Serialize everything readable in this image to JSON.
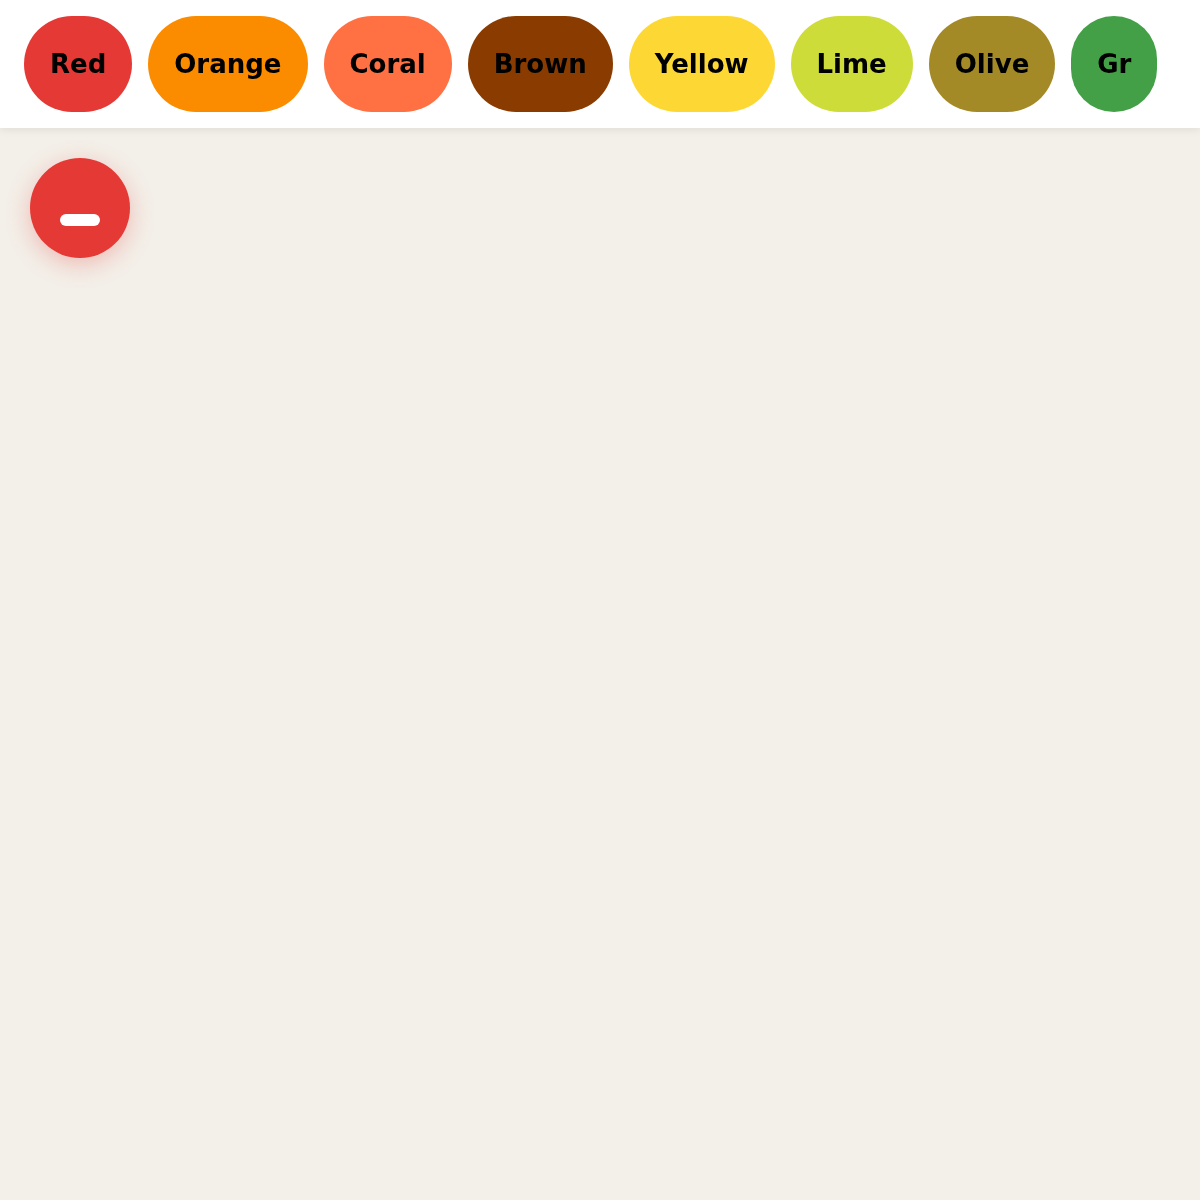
{
  "chips": [
    {
      "label": "Red",
      "color": "#e53935"
    },
    {
      "label": "Orange",
      "color": "#fb8c00"
    },
    {
      "label": "Coral",
      "color": "#ff7043"
    },
    {
      "label": "Brown",
      "color": "#8a3c00"
    },
    {
      "label": "Yellow",
      "color": "#fdd835"
    },
    {
      "label": "Lime",
      "color": "#cddc39"
    },
    {
      "label": "Olive",
      "color": "#a38a27"
    },
    {
      "label": "Gr",
      "color": "#43a047"
    }
  ],
  "fab": {
    "color": "#e53935"
  }
}
